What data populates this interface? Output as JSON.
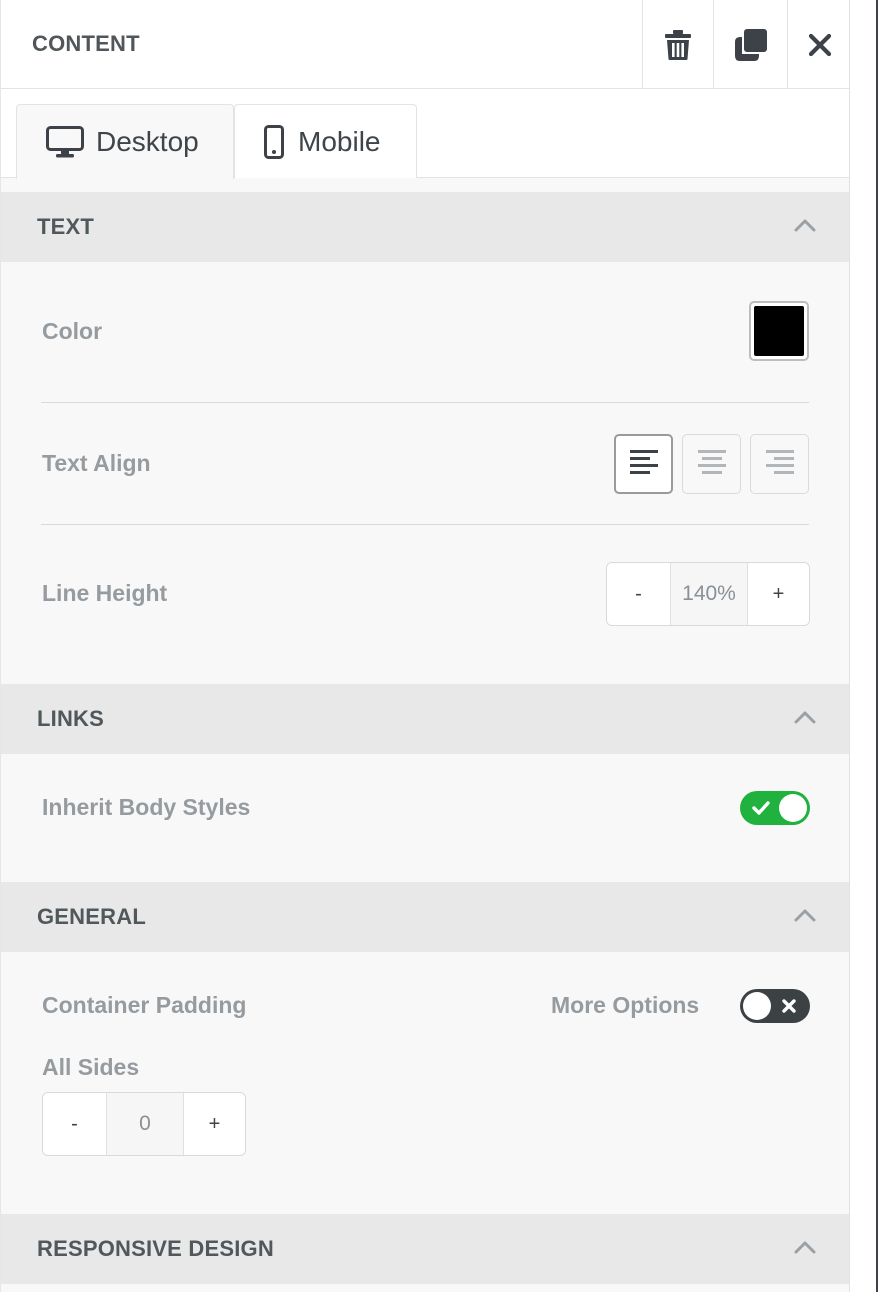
{
  "header": {
    "title": "CONTENT",
    "actions": [
      {
        "name": "delete",
        "icon": "trash-icon"
      },
      {
        "name": "duplicate",
        "icon": "duplicate-icon"
      },
      {
        "name": "close",
        "icon": "close-icon"
      }
    ]
  },
  "tabs": [
    {
      "label": "Desktop",
      "icon": "desktop-icon",
      "active": true
    },
    {
      "label": "Mobile",
      "icon": "mobile-icon",
      "active": false
    }
  ],
  "sections": {
    "text": {
      "title": "TEXT",
      "color_label": "Color",
      "color_value": "#000000",
      "align_label": "Text Align",
      "align_options": [
        "left",
        "center",
        "right"
      ],
      "align_selected": "left",
      "line_height_label": "Line Height",
      "line_height_value": "140%",
      "minus": "-",
      "plus": "+"
    },
    "links": {
      "title": "LINKS",
      "inherit_label": "Inherit Body Styles",
      "inherit_on": true
    },
    "general": {
      "title": "GENERAL",
      "padding_label": "Container Padding",
      "more_options_label": "More Options",
      "more_options_on": false,
      "all_sides_label": "All Sides",
      "padding_value": "0",
      "minus": "-",
      "plus": "+"
    },
    "responsive": {
      "title": "RESPONSIVE DESIGN"
    }
  },
  "colors": {
    "toggle_on": "#20b13e",
    "toggle_off": "#3c4144",
    "section_header_bg": "#e8e8e8",
    "panel_bg": "#f8f8f8"
  }
}
